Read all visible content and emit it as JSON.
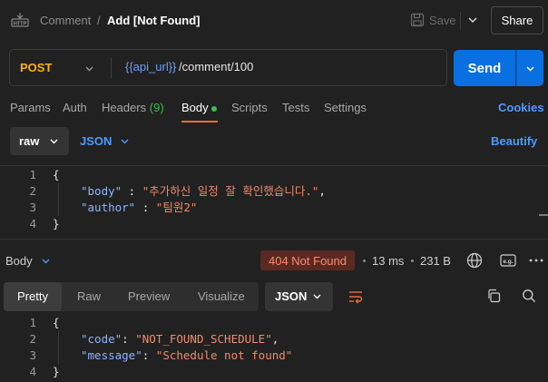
{
  "header": {
    "icon": "http-icon",
    "breadcrumb_parent": "Comment",
    "breadcrumb_sep": "/",
    "title": "Add [Not Found]",
    "save_label": "Save",
    "share_label": "Share"
  },
  "request": {
    "method": "POST",
    "url_variable": "{{api_url}}",
    "url_path": "/comment/100",
    "send_label": "Send"
  },
  "request_tabs": {
    "params": "Params",
    "auth": "Auth",
    "headers": "Headers",
    "headers_count": "(9)",
    "body": "Body",
    "scripts": "Scripts",
    "tests": "Tests",
    "settings": "Settings",
    "cookies": "Cookies"
  },
  "body_toolbar": {
    "mode": "raw",
    "format": "JSON",
    "beautify": "Beautify"
  },
  "request_body": {
    "line_numbers": [
      "1",
      "2",
      "3",
      "4"
    ],
    "open_brace": "{",
    "close_brace": "}",
    "key1": "\"body\"",
    "sep1": " : ",
    "val1": "\"추가하신 일정 잘 확인했습니다.\"",
    "comma": ",",
    "key2": "\"author\"",
    "sep2": " : ",
    "val2": "\"팀원2\""
  },
  "response": {
    "label": "Body",
    "status": "404 Not Found",
    "time": "13 ms",
    "size": "231 B"
  },
  "response_tabs": {
    "pretty": "Pretty",
    "raw": "Raw",
    "preview": "Preview",
    "visualize": "Visualize",
    "format": "JSON"
  },
  "response_body": {
    "line_numbers": [
      "1",
      "2",
      "3",
      "4"
    ],
    "open_brace": "{",
    "close_brace": "}",
    "key1": "\"code\"",
    "sep1": ": ",
    "val1": "\"NOT_FOUND_SCHEDULE\"",
    "comma": ",",
    "key2": "\"message\"",
    "sep2": ": ",
    "val2": "\"Schedule not found\""
  },
  "colors": {
    "background": "#212121",
    "method": "#ffb400",
    "accent_blue": "#0a6fe0",
    "link_blue": "#4d9bff",
    "status_error_bg": "#5a2a22",
    "status_error_text": "#ff8a70",
    "tab_underline": "#f26b3a",
    "json_key": "#8fb4ff",
    "json_string": "#f08a6c"
  }
}
